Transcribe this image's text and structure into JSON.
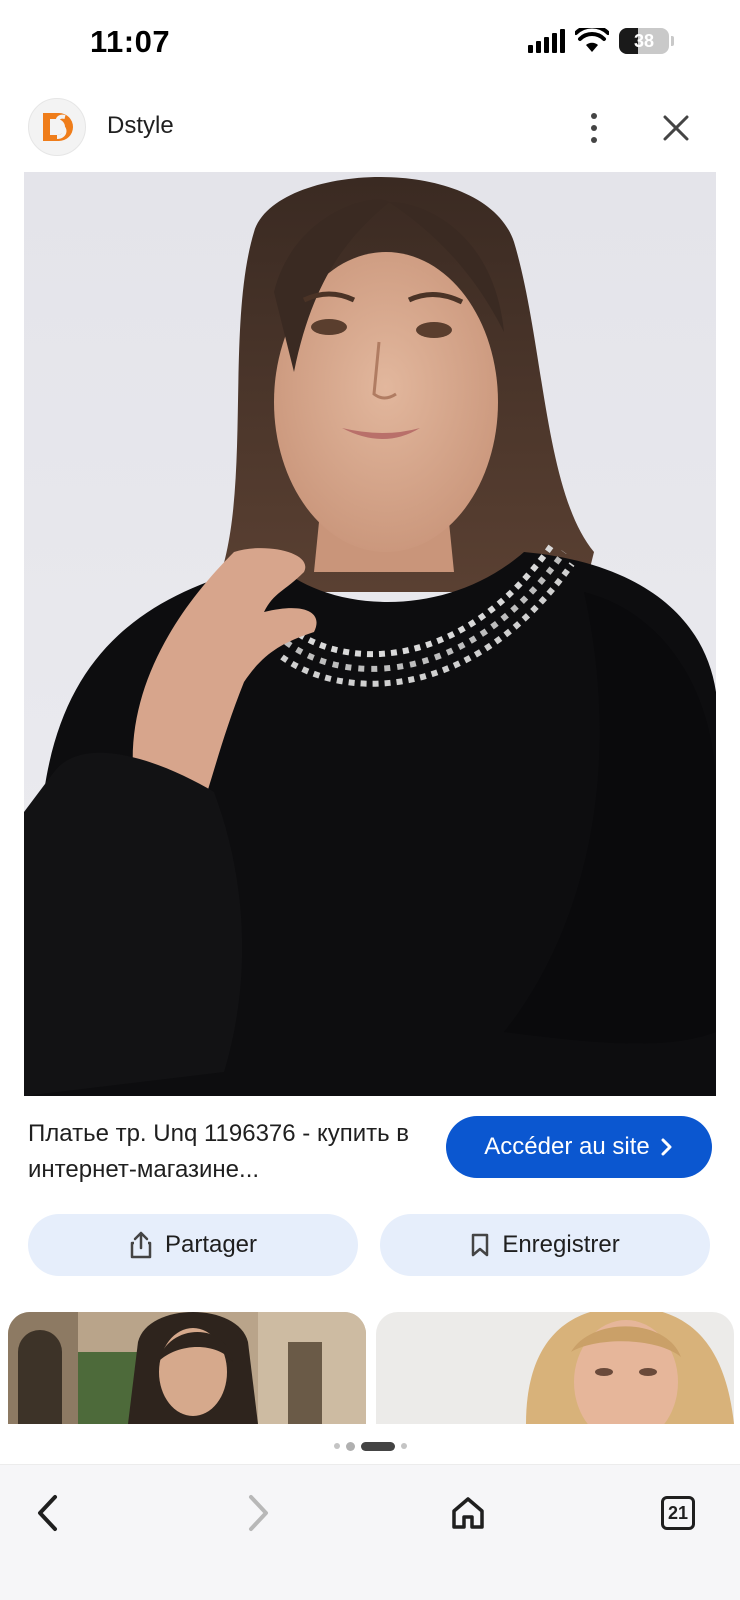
{
  "status_bar": {
    "time": "11:07",
    "battery_percent": 38,
    "battery_label": "38",
    "icons": [
      "signal-icon",
      "wifi-icon",
      "battery-icon"
    ]
  },
  "header": {
    "site_name": "Dstyle",
    "logo_icon": "dstyle-logo",
    "logo_color": "#ef7d1a",
    "more_icon": "more-vert-icon",
    "close_icon": "close-icon"
  },
  "result": {
    "title": "Платье тр. Unq 1196376 - купить в интернет-магазине...",
    "visit_label": "Accéder au site",
    "visit_color": "#0b57d0"
  },
  "actions": {
    "share_label": "Partager",
    "save_label": "Enregistrer",
    "button_bg": "#e6eefb"
  },
  "pager": {
    "active_index": 2,
    "count": 4
  },
  "bottom_nav": {
    "back_icon": "back-arrow-icon",
    "forward_icon": "forward-arrow-icon",
    "home_icon": "home-icon",
    "tabs_count": "21"
  }
}
